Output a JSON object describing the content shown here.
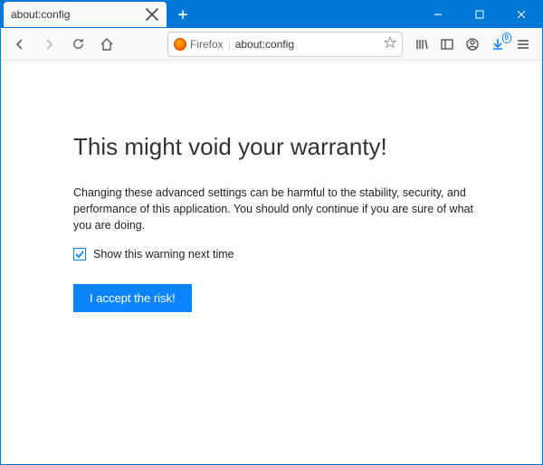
{
  "tab": {
    "title": "about:config"
  },
  "urlbar": {
    "identity": "Firefox",
    "url": "about:config"
  },
  "toolbar_badge": {
    "count": "0"
  },
  "page": {
    "heading": "This might void your warranty!",
    "paragraph": "Changing these advanced settings can be harmful to the stability, security, and performance of this application. You should only continue if you are sure of what you are doing.",
    "checkbox_label": "Show this warning next time",
    "accept_label": "I accept the risk!"
  }
}
